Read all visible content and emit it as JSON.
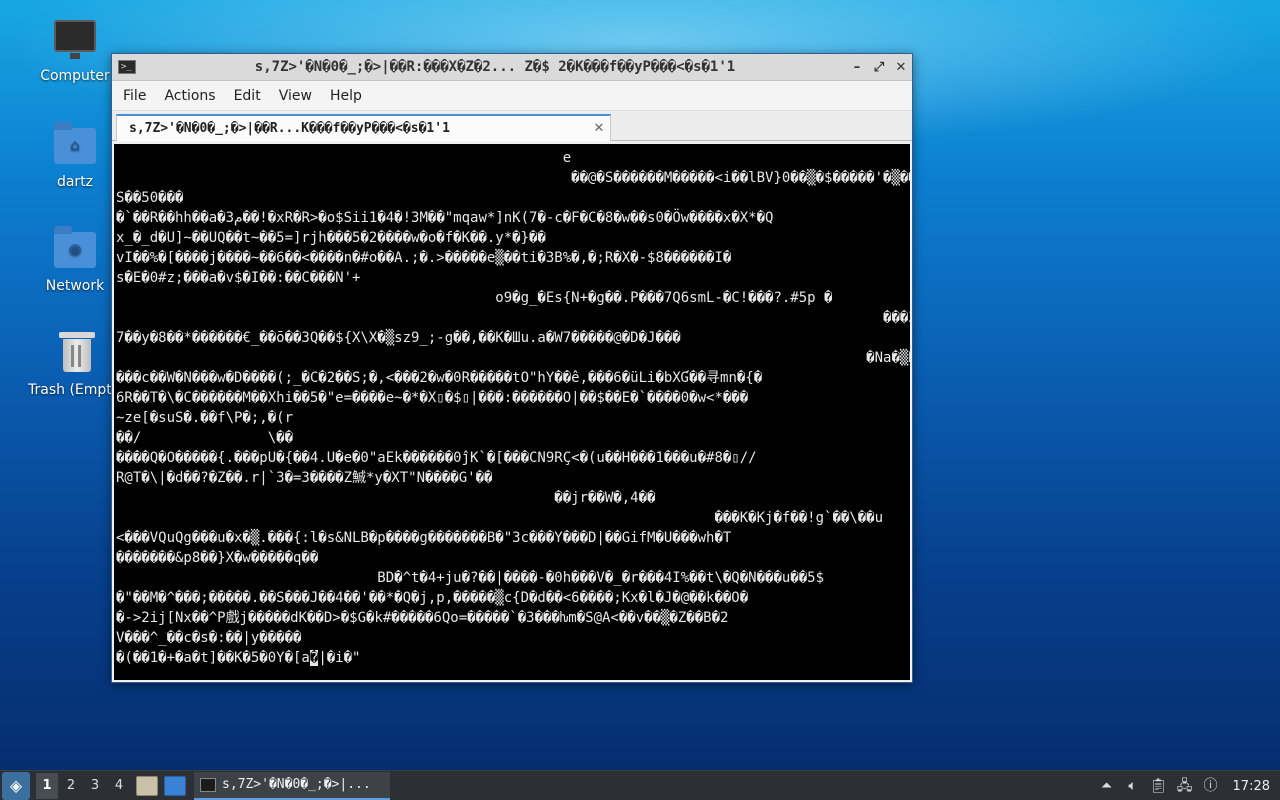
{
  "desktop": {
    "icons": [
      {
        "label": "Computer"
      },
      {
        "label": "dartz"
      },
      {
        "label": "Network"
      },
      {
        "label": "Trash (Empty)"
      }
    ]
  },
  "window": {
    "title": "s,7Z>'�N�0�_;�>|��R:���X�Z�2...  Z�$ 2�K���f��yP���<�s�1'1",
    "menu": [
      "File",
      "Actions",
      "Edit",
      "View",
      "Help"
    ],
    "tab_label": "s,7Z>'�N�0�_;�>|��R...K���f��yP���<�s�1'1",
    "terminal_lines": [
      "                                                     e",
      "                                                      ��@�S������M�����<i��lBV}0��▒�$�����'�▒��",
      "S��50���",
      "�`��R��hh��a�م3��!�xR�R>�o$Sii1�4�!3M��\"mqaw*]nK(7�-c�F�C�8�w��s0�Öw����x�X*�Q",
      "x_�_d�U]~��UQ��t~��5=]rjh���5�2����w�o�f�K��.y*�}��",
      "vI��%�[����j����~��6��<����n�#o��A.;�.>�����e▒��ti�3B%�,�;R�X�-$8������I�",
      "s�E�0#z;���a�v$�I��:��C���N'+",
      "                                             o9�g_�Es{N+�g��.P���7Q6smL-�C!���?.#5p �",
      "                                                                                           ���Z▲���",
      "7��y�8��*������€_��ō��3Q��${X\\X�▒sz9_;-g��,��K�Шu.a�W7�����@�D�J���",
      "                                                                                         �Na�▒D�A▯�",
      "���c��W�N���w�D����(;_�C�2��S;�,<���2�w�0R�����tO\"hY��ê,���6�üLi�bXƓ��寻mn�{�",
      "6R��T�\\�C������M��Xhi��5�\"e=����e~�*�X▯�$▯|���:������O|��$��E�`����0�w<*���",
      "~ze[�suS�.��f\\P�;,�(r",
      "��/               \\��",
      "����Q�O�����{.���pU�{��4.U�e�0\"aEk������0ĵK`�[���CN9RÇ<�(u��H���1���u�#8�▯//",
      "R@T�\\|�d��?�Z��.r|`3�=3����Z鯎*y�XT\"N����G'��",
      "                                                    ��jr��W�,4��",
      "                                                                       ���K�Kj�f��!g`��\\��u",
      "<���VQuQg���u�x�▒.���{:l�s&NLB�p����g�������B�\"3c���Y���D|��GifM�U���wh�T",
      "�������&p8��}X�w�����q��",
      "                               BD�^t�4+ju�?��|����-�0h���V�_�r���4I%��t\\�Q�N���u��5$",
      "�\"��M�^���;�����.��S���J��4��'��*�Q�j,p,�����▒c{D�d��<6����;Kx�l�J�@��k��O�",
      "�->2ij[Nx��^P戲j�����dK��D>�$G�k#�����6Qo=�����`�3���ƕm�S@A<��v��▒�Z��B�2",
      "V���^_��c�s�:��|y�����",
      "�(��1�+�a�t]��K�5�0Y�[a"
    ],
    "cursor_char": "�",
    "after_cursor": "|�i�\""
  },
  "taskbar": {
    "workspaces": [
      "1",
      "2",
      "3",
      "4"
    ],
    "active_workspace": "1",
    "task_label": "s,7Z>'�N�0�_;�>|...",
    "clock": "17:28"
  }
}
